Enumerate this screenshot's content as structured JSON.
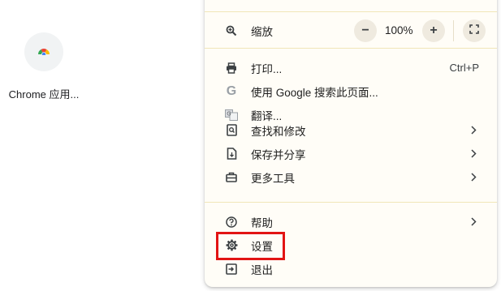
{
  "desktop": {
    "shortcut_label": "Chrome 应用..."
  },
  "menu": {
    "zoom": {
      "label": "缩放",
      "minus": "−",
      "value": "100%",
      "plus": "+"
    },
    "print": {
      "label": "打印...",
      "shortcut": "Ctrl+P"
    },
    "search_google": {
      "label": "使用 Google 搜索此页面..."
    },
    "translate": {
      "label": "翻译..."
    },
    "find_edit": {
      "label": "查找和修改"
    },
    "save_share": {
      "label": "保存并分享"
    },
    "more_tools": {
      "label": "更多工具"
    },
    "help": {
      "label": "帮助"
    },
    "settings": {
      "label": "设置"
    },
    "exit": {
      "label": "退出"
    }
  },
  "colors": {
    "menu_background": "#fffdf7",
    "separator": "#f1e6b8",
    "highlight_border": "#e21414"
  }
}
